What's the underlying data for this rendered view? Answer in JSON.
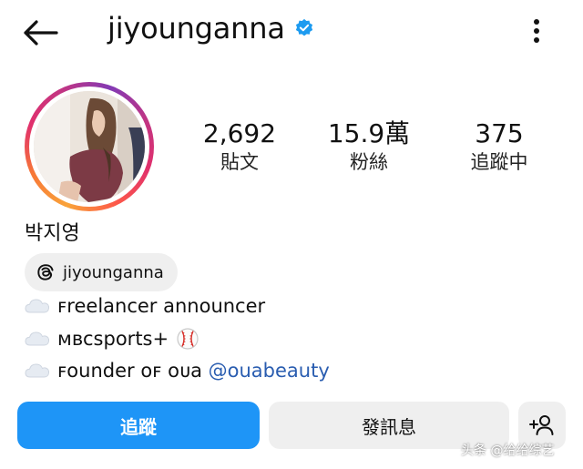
{
  "header": {
    "username": "jiyounganna",
    "back_icon": "arrow-left-icon",
    "verified_icon": "verified-badge-icon",
    "more_icon": "more-vertical-icon"
  },
  "profile": {
    "full_name": "박지영",
    "avatar_icon": "profile-photo",
    "stats": [
      {
        "number": "2,692",
        "label": "貼文"
      },
      {
        "number": "15.9萬",
        "label": "粉絲"
      },
      {
        "number": "375",
        "label": "追蹤中"
      }
    ],
    "threads": {
      "handle": "jiyounganna",
      "icon": "threads-icon"
    },
    "bio": [
      {
        "icon": "cloud-icon",
        "text": "ꜰreelancer announcer"
      },
      {
        "icon": "cloud-icon",
        "text": "ᴍʙcsports+",
        "trailing_icon": "baseball-icon"
      },
      {
        "icon": "cloud-icon",
        "text": "ꜰounder oꜰ oᴜa ",
        "mention": "@ouabeauty"
      }
    ]
  },
  "actions": {
    "follow_label": "追蹤",
    "message_label": "發訊息",
    "add_person_icon": "add-person-icon"
  },
  "watermark": "头条 @给给综艺",
  "colors": {
    "follow_button": "#1e95f7",
    "secondary_button": "#efefef",
    "verified": "#1d9bf0",
    "mention": "#2a5db0"
  }
}
